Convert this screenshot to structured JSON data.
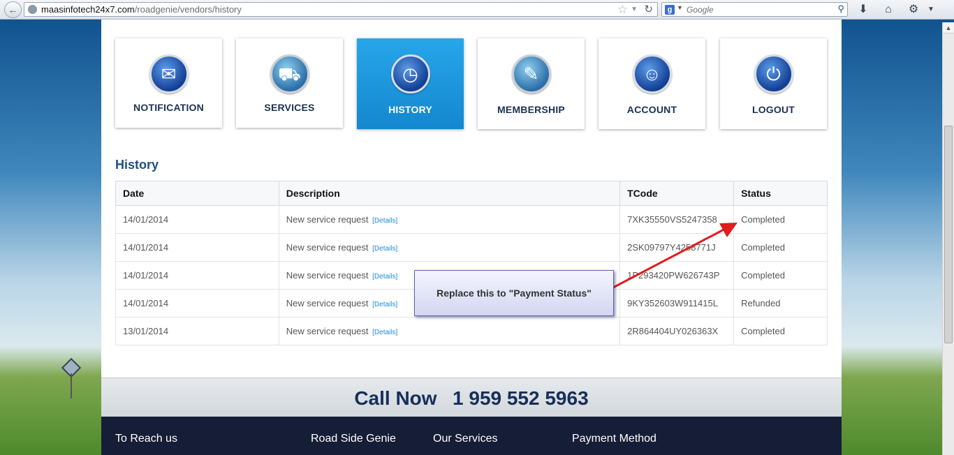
{
  "browser": {
    "url_host": "maasinfotech24x7.com",
    "url_path": "/roadgenie/vendors/history",
    "search_placeholder": "Google"
  },
  "nav_tiles": [
    {
      "label": "NOTIFICATION",
      "icon": "envelope-icon"
    },
    {
      "label": "SERVICES",
      "icon": "tow-truck-icon"
    },
    {
      "label": "HISTORY",
      "icon": "clock-icon"
    },
    {
      "label": "MEMBERSHIP",
      "icon": "membership-card-icon"
    },
    {
      "label": "ACCOUNT",
      "icon": "user-icon"
    },
    {
      "label": "LOGOUT",
      "icon": "power-icon"
    }
  ],
  "history": {
    "title": "History",
    "columns": [
      "Date",
      "Description",
      "TCode",
      "Status"
    ],
    "details_label": "[Details]",
    "rows": [
      {
        "date": "14/01/2014",
        "description": "New service request",
        "tcode": "7XK35550VS5247358",
        "status": "Completed"
      },
      {
        "date": "14/01/2014",
        "description": "New service request",
        "tcode": "2SK09797Y4258771J",
        "status": "Completed"
      },
      {
        "date": "14/01/2014",
        "description": "New service request",
        "tcode": "1P293420PW626743P",
        "status": "Completed"
      },
      {
        "date": "14/01/2014",
        "description": "New service request",
        "tcode": "9KY352603W911415L",
        "status": "Refunded"
      },
      {
        "date": "13/01/2014",
        "description": "New service request",
        "tcode": "2R864404UY026363X",
        "status": "Completed"
      }
    ]
  },
  "annotation": {
    "text": "Replace this to \"Payment Status\""
  },
  "callbar": {
    "label": "Call Now",
    "number": "1 959 552 5963"
  },
  "footer": {
    "columns": [
      "To Reach us",
      "Road Side Genie",
      "Our Services",
      "Payment Method"
    ]
  }
}
